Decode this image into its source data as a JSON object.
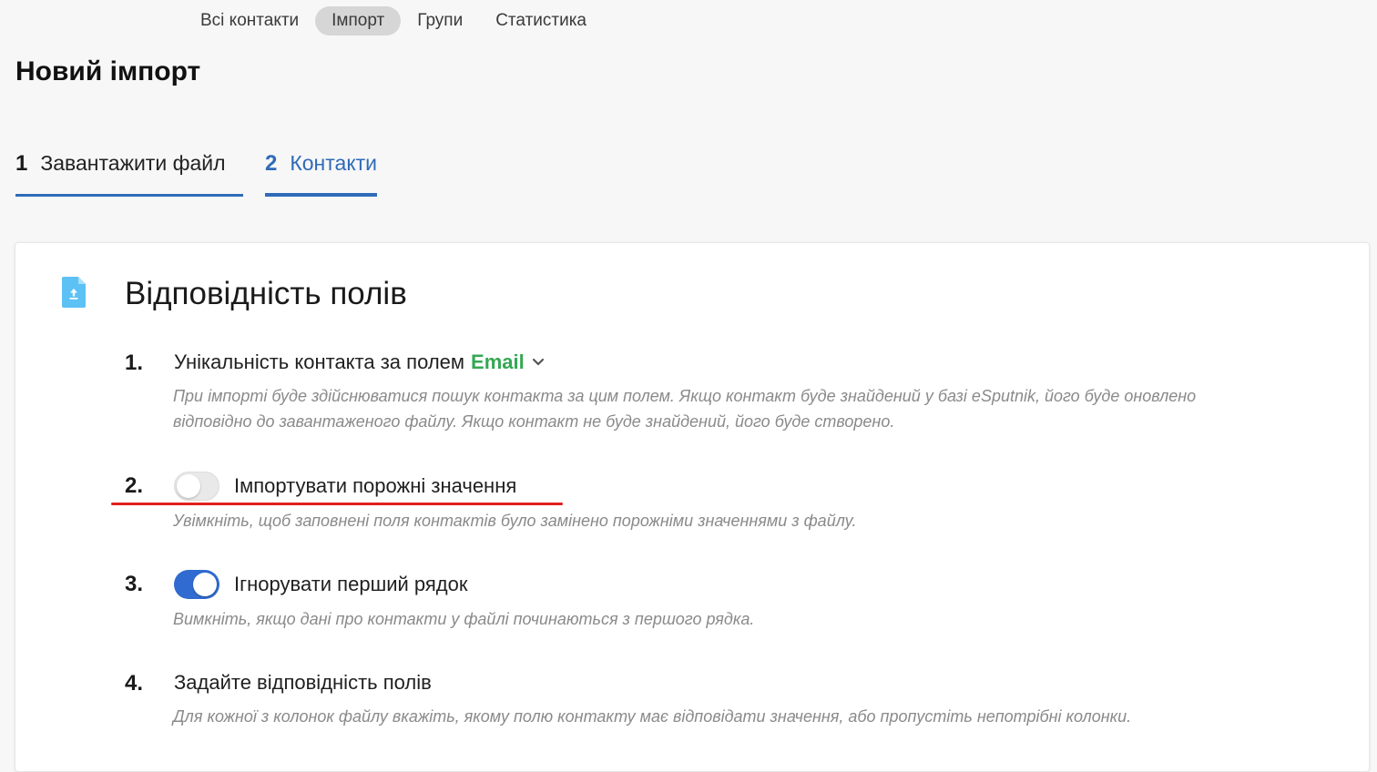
{
  "top_tabs": [
    {
      "label": "Всі контакти",
      "active": false
    },
    {
      "label": "Імпорт",
      "active": true
    },
    {
      "label": "Групи",
      "active": false
    },
    {
      "label": "Статистика",
      "active": false
    }
  ],
  "page_title": "Новий імпорт",
  "steps": [
    {
      "num": "1",
      "label": "Завантажити файл"
    },
    {
      "num": "2",
      "label": "Контакти"
    }
  ],
  "card": {
    "icon": "file-upload-icon",
    "title": "Відповідність полів",
    "items": [
      {
        "num": "1.",
        "label": "Унікальність контакта за полем",
        "field": "Email",
        "desc_line1": "При імпорті буде здійснюватися пошук контакта за цим полем. Якщо контакт буде знайдений у базі eSputnik, його буде оновлено",
        "desc_line2": "відповідно до завантаженого файлу. Якщо контакт не буде знайдений, його буде створено."
      },
      {
        "num": "2.",
        "label": "Імпортувати порожні значення",
        "toggle": false,
        "desc": "Увімкніть, щоб заповнені поля контактів було замінено порожніми значеннями з файлу."
      },
      {
        "num": "3.",
        "label": "Ігнорувати перший рядок",
        "toggle": true,
        "desc": "Вимкніть, якщо дані про контакти у файлі починаються з першого рядка."
      },
      {
        "num": "4.",
        "label": "Задайте відповідність полів",
        "desc": "Для кожної з колонок файлу вкажіть, якому полю контакту має відповідати значення, або пропустіть непотрібні колонки."
      }
    ]
  },
  "colors": {
    "accent": "#2f6bb8",
    "toggle_on": "#2f6bd0",
    "email_green": "#34a853",
    "annotation_red": "#e0201e"
  }
}
